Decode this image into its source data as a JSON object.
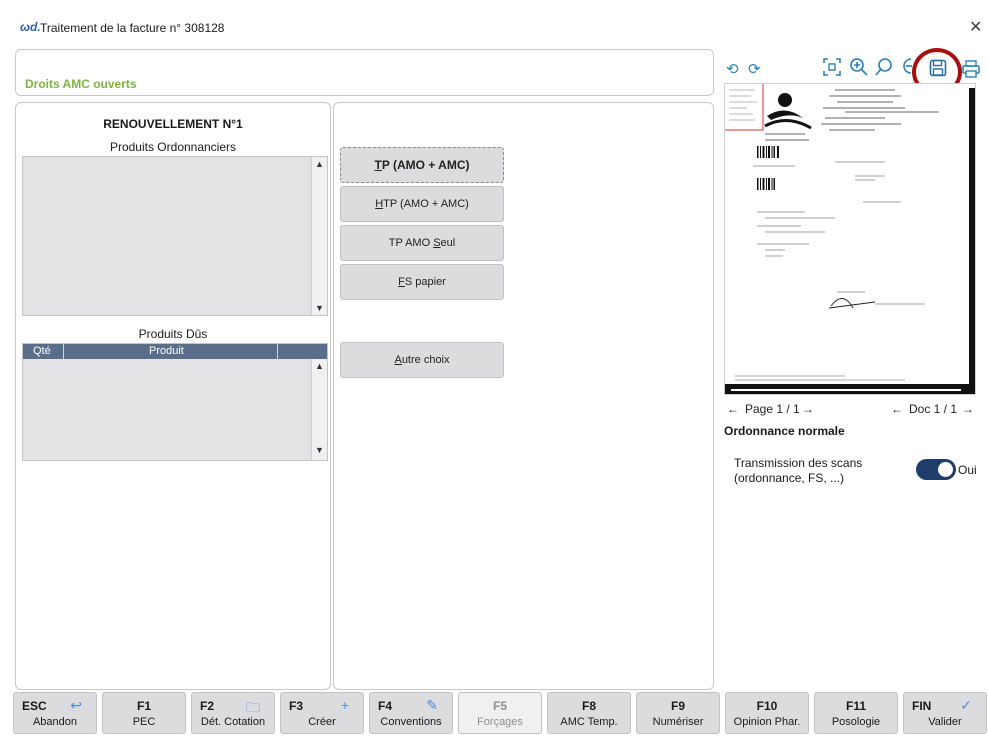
{
  "window": {
    "logo": "ωd.",
    "title": "Traitement de la facture n° 308128",
    "close_icon": "✕"
  },
  "droits": {
    "label": "Droits AMC ouverts"
  },
  "left": {
    "renouvellement": "RENOUVELLEMENT N°1",
    "produits_ordonnanciers": "Produits Ordonnanciers",
    "produits_dus": "Produits Dûs",
    "grid_headers": [
      "Qté",
      "Produit"
    ]
  },
  "middle": {
    "buttons": [
      {
        "key": "T",
        "rest": "P (AMO + AMC)"
      },
      {
        "key": "H",
        "rest": "TP (AMO + AMC)"
      },
      {
        "pre": "TP AMO ",
        "key": "S",
        "rest": "eul"
      },
      {
        "key": "F",
        "rest": "S papier"
      },
      {
        "key": "A",
        "rest": "utre choix"
      }
    ]
  },
  "viewer": {
    "page_nav": "Page 1 / 1",
    "doc_nav": "Doc 1 / 1",
    "ordonnance": "Ordonnance normale",
    "transmission_line1": "Transmission des scans",
    "transmission_line2": "(ordonnance, FS, ...)",
    "toggle_label": "Oui",
    "toggle_on": true
  },
  "fkeys": [
    {
      "key": "ESC",
      "label": "Abandon",
      "icon": "undo-icon",
      "glyph": "↩",
      "enabled": true
    },
    {
      "key": "F1",
      "label": "PEC",
      "icon": "",
      "glyph": "",
      "enabled": true
    },
    {
      "key": "F2",
      "label": "Dét. Cotation",
      "icon": "folder-icon",
      "glyph": "🗀",
      "enabled": true
    },
    {
      "key": "F3",
      "label": "Créer",
      "icon": "plus-icon",
      "glyph": "+",
      "enabled": true
    },
    {
      "key": "F4",
      "label": "Conventions",
      "icon": "pencil-icon",
      "glyph": "✎",
      "enabled": true
    },
    {
      "key": "F5",
      "label": "Forçages",
      "icon": "",
      "glyph": "",
      "enabled": false
    },
    {
      "key": "F8",
      "label": "AMC Temp.",
      "icon": "",
      "glyph": "",
      "enabled": true
    },
    {
      "key": "F9",
      "label": "Numériser",
      "icon": "",
      "glyph": "",
      "enabled": true
    },
    {
      "key": "F10",
      "label": "Opinion Phar.",
      "icon": "",
      "glyph": "",
      "enabled": true
    },
    {
      "key": "F11",
      "label": "Posologie",
      "icon": "",
      "glyph": "",
      "enabled": true
    },
    {
      "key": "FIN",
      "label": "Valider",
      "icon": "check-icon",
      "glyph": "✓",
      "enabled": true
    }
  ],
  "colors": {
    "accent": "#2b7fb8",
    "droits": "#7cb342",
    "highlight": "#a80f0f",
    "toggle": "#1f3d6b"
  }
}
